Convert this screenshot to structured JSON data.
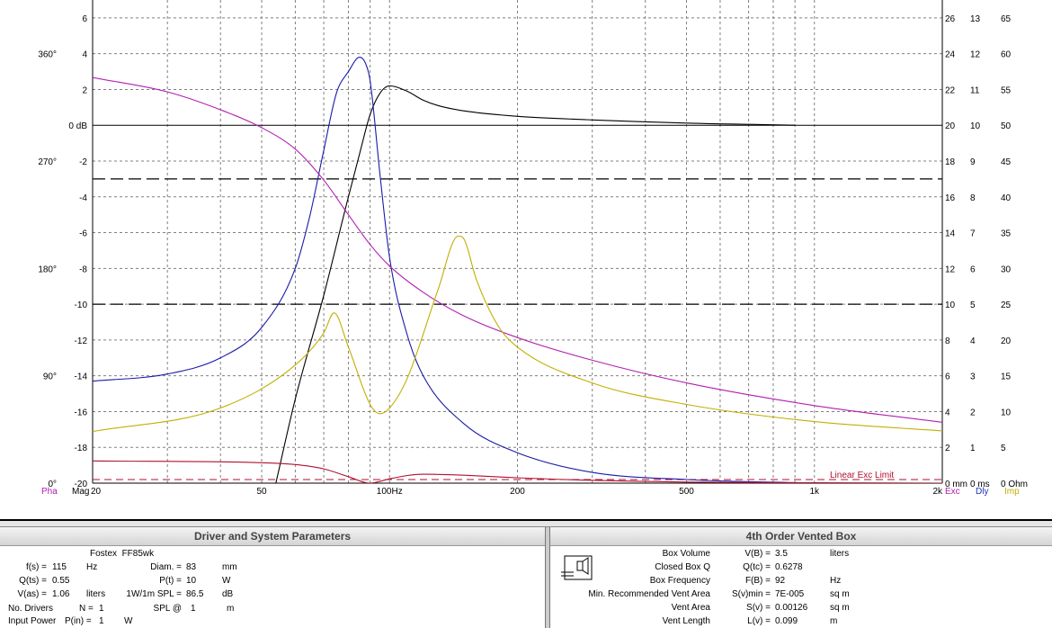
{
  "plot": {
    "left_axis": {
      "db_ticks": [
        "6",
        "4",
        "2",
        "0 dB",
        "-2",
        "-4",
        "-6",
        "-8",
        "-10",
        "-12",
        "-14",
        "-16",
        "-18",
        "-20"
      ],
      "phase_ticks": [
        {
          "label": "360°",
          "at_db": 4
        },
        {
          "label": "270°",
          "at_db": -2
        },
        {
          "label": "180°",
          "at_db": -8
        },
        {
          "label": "90°",
          "at_db": -14
        },
        {
          "label": "0°",
          "at_db": -20
        }
      ],
      "pha_label": "Pha",
      "mag_label": "Mag"
    },
    "right_axis": {
      "col1": [
        "26",
        "24",
        "22",
        "20",
        "18",
        "16",
        "14",
        "12",
        "10",
        "8",
        "6",
        "4",
        "2",
        "0 mm"
      ],
      "col2": [
        "13",
        "12",
        "11",
        "10",
        "9",
        "8",
        "7",
        "6",
        "5",
        "4",
        "3",
        "2",
        "1",
        "0 ms"
      ],
      "col3": [
        "65",
        "60",
        "55",
        "50",
        "45",
        "40",
        "35",
        "30",
        "25",
        "20",
        "15",
        "10",
        "5",
        "0 Ohm"
      ],
      "col3_start_index": 0,
      "exc_label": "Exc",
      "dly_label": "Dly",
      "imp_label": "Imp"
    },
    "x_ticks": [
      {
        "label": "20",
        "f": 20
      },
      {
        "label": "50",
        "f": 50
      },
      {
        "label": "100Hz",
        "f": 100
      },
      {
        "label": "200",
        "f": 200
      },
      {
        "label": "500",
        "f": 500
      },
      {
        "label": "1k",
        "f": 1000
      },
      {
        "label": "2k",
        "f": 2000
      }
    ],
    "annotation": "Linear Exc Limit",
    "colors": {
      "grid": "#808080",
      "magnitude": "#000000",
      "excursion": "#1a1aa8",
      "phase": "#b020b0",
      "impedance": "#c0b000",
      "delay": "#b01030",
      "left_labels": "#b020b0",
      "exc_label": "#b020b0",
      "dly_label": "#2030c0",
      "imp_label": "#c0b000"
    }
  },
  "chart_data": {
    "type": "line",
    "xscale": "log",
    "xlim": [
      20,
      2000
    ],
    "ylim": [
      -20,
      7
    ],
    "ylabel": "dB",
    "reference_lines_db": [
      0,
      -3,
      -10
    ],
    "series": [
      {
        "key": "magnitude",
        "axis": "dB",
        "x": [
          54,
          60,
          70,
          80,
          85,
          90,
          95,
          100,
          110,
          120,
          130,
          150,
          200,
          300,
          500,
          700,
          900
        ],
        "y": [
          -20,
          -15.3,
          -9.5,
          -4,
          -1.6,
          0.6,
          1.8,
          2.2,
          1.9,
          1.4,
          1.1,
          0.8,
          0.5,
          0.3,
          0.12,
          0.05,
          0
        ]
      },
      {
        "key": "excursion",
        "axis": "mm",
        "x": [
          20,
          30,
          40,
          50,
          60,
          65,
          70,
          75,
          80,
          85,
          88,
          90,
          95,
          100,
          110,
          120,
          150,
          200,
          300,
          500,
          1000
        ],
        "y": [
          5.7,
          6.1,
          7,
          8.7,
          12,
          15,
          18.6,
          21.8,
          23,
          23.8,
          23.4,
          22.5,
          17.2,
          12.6,
          8.3,
          6,
          3.3,
          1.7,
          0.6,
          0.2,
          0
        ]
      },
      {
        "key": "phase",
        "axis": "deg",
        "x": [
          20,
          30,
          40,
          50,
          60,
          70,
          80,
          90,
          100,
          120,
          150,
          200,
          300,
          500,
          1000,
          2000
        ],
        "y": [
          340,
          328,
          313,
          298,
          280,
          254,
          225,
          200,
          182,
          160,
          140,
          122,
          103,
          84,
          65,
          51
        ]
      },
      {
        "key": "impedance",
        "axis": "Ohm",
        "x": [
          20,
          40,
          60,
          70,
          74,
          80,
          90,
          95,
          100,
          110,
          130,
          145,
          150,
          160,
          180,
          200,
          300,
          500,
          1000,
          2000
        ],
        "y": [
          7.2,
          10.5,
          16.5,
          21,
          23.8,
          19,
          11,
          9.7,
          10.5,
          14.6,
          27,
          34.5,
          34,
          28.5,
          22,
          19,
          14,
          11,
          8.6,
          7.3
        ]
      },
      {
        "key": "delay",
        "axis": "ms",
        "x": [
          20,
          50,
          60,
          70,
          80,
          90,
          95,
          100,
          120,
          150,
          200,
          300,
          500,
          1000,
          2000
        ],
        "y": [
          0.62,
          0.57,
          0.52,
          0.4,
          0.18,
          0,
          0.05,
          0.12,
          0.25,
          0.22,
          0.15,
          0.08,
          0.03,
          0.01,
          0
        ]
      }
    ]
  },
  "driver_panel": {
    "title": "Driver and System Parameters",
    "driver_name": "Fostex  FF85wk",
    "fs_label": "f(s) =",
    "fs_value": "115",
    "fs_unit": "Hz",
    "qts_label": "Q(ts) =",
    "qts_value": "0.55",
    "vas_label": "V(as) =",
    "vas_value": "1.06",
    "vas_unit": "liters",
    "drivers_label": "No. Drivers",
    "drivers_n_label": "N =",
    "drivers_value": "1",
    "power_label": "Input Power",
    "power_p_label": "P(in) =",
    "power_value": "1",
    "power_unit": "W",
    "diam_label": "Diam. =",
    "diam_value": "83",
    "diam_unit": "mm",
    "pt_label": "P(t) =",
    "pt_value": "10",
    "pt_unit": "W",
    "spl_label": "1W/1m SPL =",
    "spl_value": "86.5",
    "spl_unit": "dB",
    "splat_label": "SPL @",
    "splat_value": "1",
    "splat_unit": "m"
  },
  "box_panel": {
    "title": "4th Order Vented Box",
    "rows": [
      {
        "label": "Box Volume",
        "sym": "V(B) =",
        "value": "3.5",
        "unit": "liters"
      },
      {
        "label": "Closed Box Q",
        "sym": "Q(tc) =",
        "value": "0.6278",
        "unit": ""
      },
      {
        "label": "Box Frequency",
        "sym": "F(B) =",
        "value": "92",
        "unit": "Hz"
      },
      {
        "label": "Min. Recommended Vent Area",
        "sym": "S(v)min =",
        "value": "7E-005",
        "unit": "sq m"
      },
      {
        "label": "Vent Area",
        "sym": "S(v) =",
        "value": "0.00126",
        "unit": "sq m"
      },
      {
        "label": "Vent Length",
        "sym": "L(v) =",
        "value": "0.099",
        "unit": "m"
      }
    ]
  }
}
